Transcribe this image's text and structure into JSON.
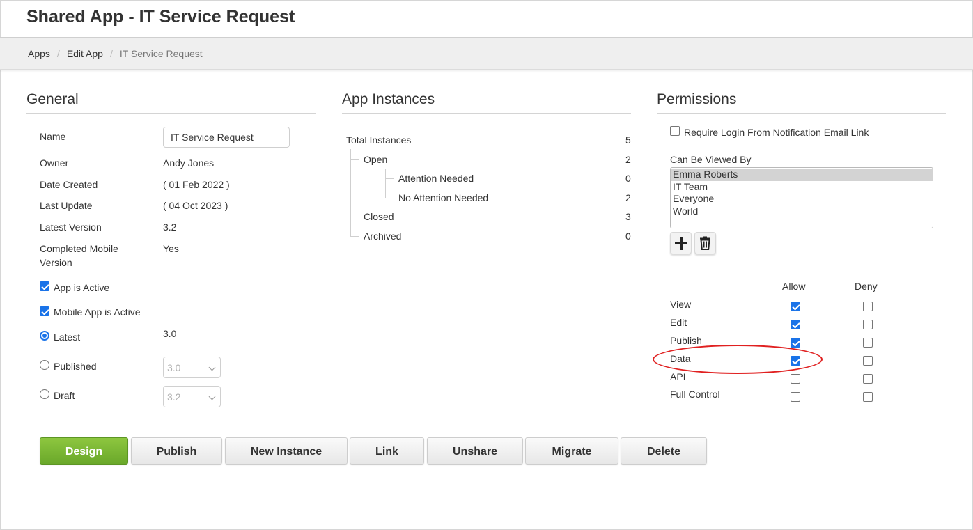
{
  "header": {
    "title": "Shared App - IT Service Request"
  },
  "breadcrumb": {
    "apps": "Apps",
    "edit_app": "Edit App",
    "current": "IT Service Request",
    "separator": "/"
  },
  "general": {
    "title": "General",
    "name_label": "Name",
    "name_value": "IT Service Request",
    "owner_label": "Owner",
    "owner_value": "Andy Jones",
    "date_created_label": "Date Created",
    "date_created_value": "( 01 Feb 2022 )",
    "last_update_label": "Last Update",
    "last_update_value": "( 04 Oct 2023 )",
    "latest_version_label": "Latest Version",
    "latest_version_value": "3.2",
    "completed_mobile_label_1": "Completed Mobile",
    "completed_mobile_label_2": "Version",
    "completed_mobile_value": "Yes",
    "app_active_label": "App is Active",
    "app_active_checked": true,
    "mobile_active_label": "Mobile App is Active",
    "mobile_active_checked": true,
    "version_options": {
      "latest_label": "Latest",
      "latest_value": "3.0",
      "published_label": "Published",
      "published_select": "3.0",
      "draft_label": "Draft",
      "draft_select": "3.2",
      "selected": "latest"
    }
  },
  "instances": {
    "title": "App Instances",
    "rows": [
      {
        "label": "Total Instances",
        "count": "5"
      },
      {
        "label": "Open",
        "count": "2"
      },
      {
        "label": "Attention Needed",
        "count": "0"
      },
      {
        "label": "No Attention Needed",
        "count": "2"
      },
      {
        "label": "Closed",
        "count": "3"
      },
      {
        "label": "Archived",
        "count": "0"
      }
    ]
  },
  "permissions": {
    "title": "Permissions",
    "require_login_label": "Require Login From Notification Email Link",
    "require_login_checked": false,
    "viewed_by_label": "Can Be Viewed By",
    "viewers": [
      "Emma Roberts",
      "IT Team",
      "Everyone",
      "World"
    ],
    "selected_viewer": "Emma Roberts",
    "allow_header": "Allow",
    "deny_header": "Deny",
    "rows": [
      {
        "label": "View",
        "allow": true,
        "deny": false
      },
      {
        "label": "Edit",
        "allow": true,
        "deny": false
      },
      {
        "label": "Publish",
        "allow": true,
        "deny": false
      },
      {
        "label": "Data",
        "allow": true,
        "deny": false
      },
      {
        "label": "API",
        "allow": false,
        "deny": false
      },
      {
        "label": "Full Control",
        "allow": false,
        "deny": false
      }
    ],
    "icons": {
      "add": "plus-icon",
      "remove": "trash-icon"
    }
  },
  "actions": {
    "design": "Design",
    "publish": "Publish",
    "new_instance": "New Instance",
    "link": "Link",
    "unshare": "Unshare",
    "migrate": "Migrate",
    "delete": "Delete"
  },
  "colors": {
    "primary_button": "#7cb733",
    "checkbox": "#1a73e8",
    "highlight": "#e02020"
  }
}
